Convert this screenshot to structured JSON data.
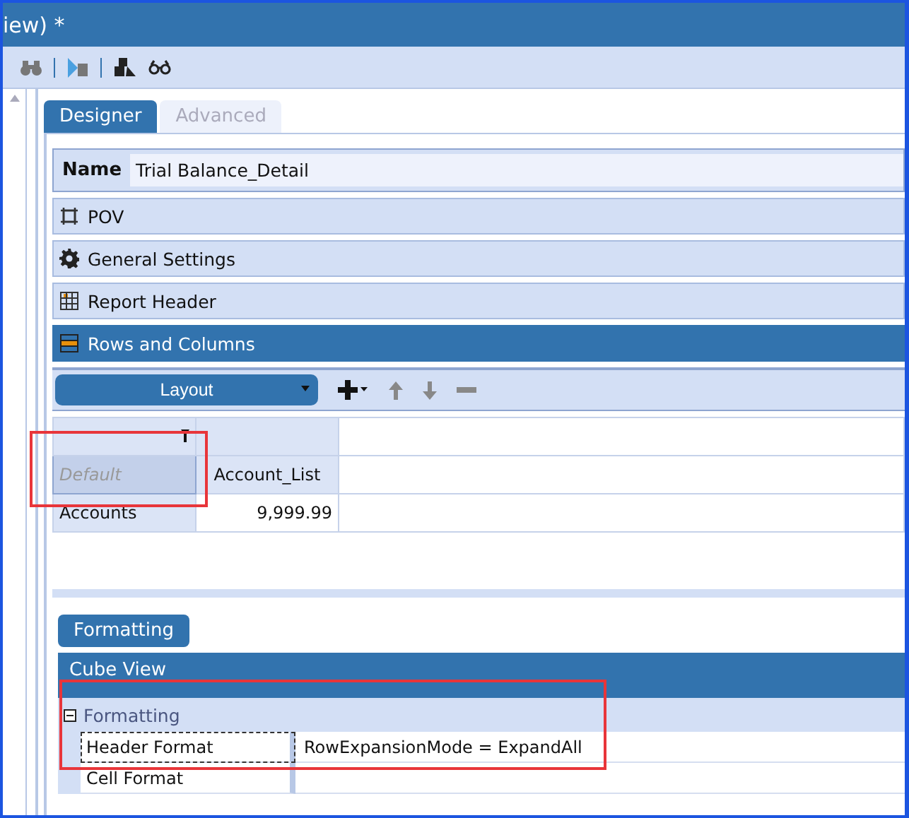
{
  "window": {
    "title": "iew) *"
  },
  "tabs": [
    {
      "label": "Designer",
      "selected": true
    },
    {
      "label": "Advanced",
      "selected": false
    }
  ],
  "name_field": {
    "label": "Name",
    "value": "Trial Balance_Detail"
  },
  "sections": [
    {
      "label": "POV",
      "kind": "pov",
      "selected": false
    },
    {
      "label": "General Settings",
      "kind": "settings",
      "selected": false
    },
    {
      "label": "Report Header",
      "kind": "header",
      "selected": false
    },
    {
      "label": "Rows and Columns",
      "kind": "grid",
      "selected": true
    }
  ],
  "layout_toolbar": {
    "dropdown": "Layout"
  },
  "grid": {
    "corner_cell": "Default",
    "column_header": "Account_List",
    "rows": [
      {
        "header": "Accounts",
        "value": "9,999.99"
      }
    ]
  },
  "formatting_button": "Formatting",
  "property_panel": {
    "title": "Cube View",
    "category": {
      "label": "Formatting",
      "expanded": true,
      "properties": [
        {
          "name": "Header Format",
          "value": "RowExpansionMode = ExpandAll",
          "selected": true
        },
        {
          "name": "Cell Format",
          "selected": false
        }
      ]
    }
  }
}
